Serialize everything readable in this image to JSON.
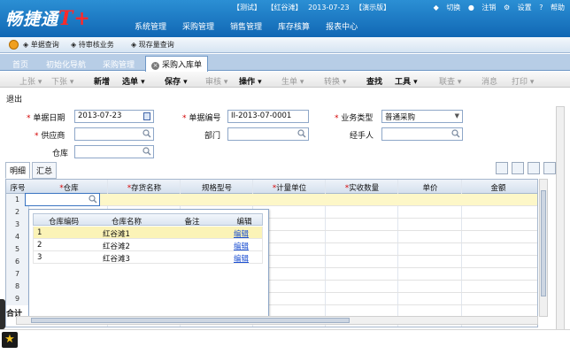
{
  "app": {
    "logo_text": "畅捷通",
    "logo_suffix": "T+"
  },
  "top_info": {
    "test": "【测试】",
    "company": "【红谷滩】",
    "date": "2013-07-23",
    "mode": "【演示版】"
  },
  "top_links": {
    "switch": "切换",
    "logout": "注销",
    "settings": "设置",
    "help": "帮助"
  },
  "main_menu": [
    "系统管理",
    "采购管理",
    "销售管理",
    "库存核算",
    "报表中心"
  ],
  "quick_nav": [
    "单据查询",
    "待审核业务",
    "现存量查询"
  ],
  "tabs": [
    "首页",
    "初始化导航",
    "采购管理",
    "采购入库单"
  ],
  "toolbar": {
    "prev": "上张",
    "next": "下张",
    "new": "新增",
    "select": "选单",
    "save": "保存",
    "audit": "审核",
    "operate": "操作",
    "generate": "生单",
    "convert": "转换",
    "find": "查找",
    "tools": "工具",
    "relate": "联查",
    "message": "消息",
    "print": "打印"
  },
  "exit_label": "退出",
  "form": {
    "doc_date_label": "单据日期",
    "doc_date": "2013-07-23",
    "doc_no_label": "单据编号",
    "doc_no": "II-2013-07-0001",
    "biz_type_label": "业务类型",
    "biz_type": "普通采购",
    "supplier_label": "供应商",
    "dept_label": "部门",
    "handler_label": "经手人",
    "warehouse_label": "仓库"
  },
  "sub_tabs": [
    "明细",
    "汇总"
  ],
  "grid": {
    "headers": [
      "序号",
      "仓库",
      "存货名称",
      "规格型号",
      "计量单位",
      "实收数量",
      "单价",
      "金额"
    ],
    "row_numbers": [
      "1",
      "2",
      "3",
      "4",
      "5",
      "6",
      "7",
      "8",
      "9"
    ],
    "total_label": "合计"
  },
  "popup": {
    "headers": [
      "仓库编码",
      "仓库名称",
      "备注",
      "编辑"
    ],
    "rows": [
      {
        "code": "1",
        "name": "红谷滩1",
        "note": "",
        "edit": "编辑"
      },
      {
        "code": "2",
        "name": "红谷滩2",
        "note": "",
        "edit": "编辑"
      },
      {
        "code": "3",
        "name": "红谷滩3",
        "note": "",
        "edit": "编辑"
      }
    ]
  }
}
